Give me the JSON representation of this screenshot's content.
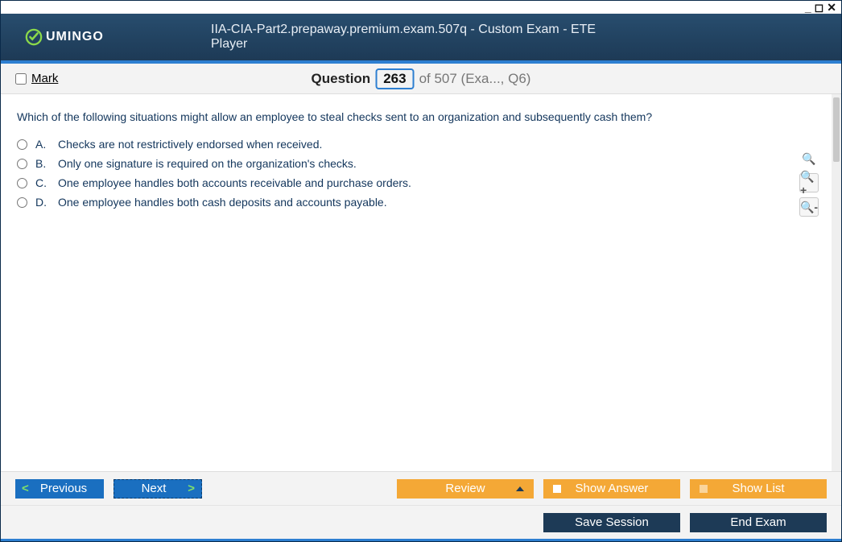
{
  "window": {
    "title": "IIA-CIA-Part2.prepaway.premium.exam.507q - Custom Exam - ETE Player",
    "brand": "UMINGO"
  },
  "mark": {
    "label": "Mark",
    "accesskey": "M"
  },
  "question_bar": {
    "label": "Question",
    "number": "263",
    "total_text": "of 507 (Exa..., Q6)"
  },
  "question": {
    "text": "Which of the following situations might allow an employee to steal checks sent to an organization and subsequently cash them?",
    "choices": [
      {
        "letter": "A.",
        "text": "Checks are not restrictively endorsed when received."
      },
      {
        "letter": "B.",
        "text": "Only one signature is required on the organization's checks."
      },
      {
        "letter": "C.",
        "text": "One employee handles both accounts receivable and purchase orders."
      },
      {
        "letter": "D.",
        "text": "One employee handles both cash deposits and accounts payable."
      }
    ]
  },
  "buttons": {
    "previous": "Previous",
    "next": "Next",
    "review": "Review",
    "show_answer": "Show Answer",
    "show_list": "Show List",
    "save_session": "Save Session",
    "end_exam": "End Exam"
  }
}
